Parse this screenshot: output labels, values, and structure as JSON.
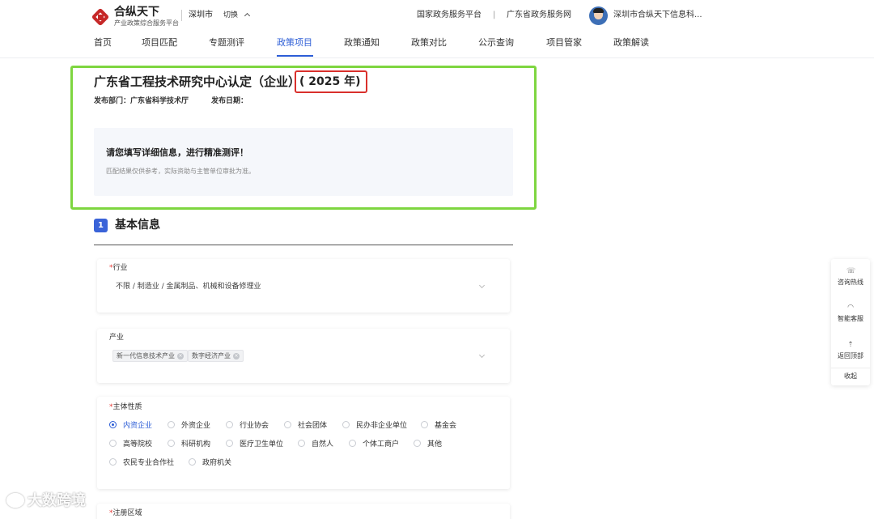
{
  "header": {
    "brand": "合纵天下",
    "brand_sub": "产业政策综合服务平台",
    "city": "深圳市",
    "switch": "切换",
    "link1": "国家政务服务平台",
    "separator": "|",
    "link2": "广东省政务服务网",
    "company": "深圳市合纵天下信息科..."
  },
  "nav": [
    "首页",
    "项目匹配",
    "专题测评",
    "政策项目",
    "政策通知",
    "政策对比",
    "公示查询",
    "项目管家",
    "政策解读"
  ],
  "page": {
    "title": "广东省工程技术研究中心认定（企业）",
    "year": "( 2025 年)",
    "dept_label": "发布部门：广东省科学技术厅",
    "date_label": "发布日期："
  },
  "prompt": {
    "title": "请您填写详细信息，进行精准测评！",
    "subtitle": "匹配结果仅供参考，实际资助与主管单位审批为准。"
  },
  "section": {
    "index": "1",
    "title": "基本信息"
  },
  "industry": {
    "label": "行业",
    "required": "*",
    "value": "不限 / 制造业 / 金属制品、机械和设备修理业"
  },
  "chan_ye": {
    "label": "产业",
    "tags": [
      "新一代信息技术产业",
      "数字经济产业"
    ],
    "remove_glyph": "×"
  },
  "entity": {
    "label": "主体性质",
    "required": "*",
    "options": [
      "内资企业",
      "外资企业",
      "行业协会",
      "社会团体",
      "民办非企业单位",
      "基金会",
      "高等院校",
      "科研机构",
      "医疗卫生单位",
      "自然人",
      "个体工商户",
      "其他",
      "农民专业合作社",
      "政府机关"
    ],
    "selected": "内资企业"
  },
  "region": {
    "label": "注册区域",
    "required": "*"
  },
  "side": {
    "hotline": "咨询热线",
    "service": "智能客服",
    "top": "返回顶部",
    "collapse": "收起"
  },
  "watermark": "大数跨境",
  "colors": {
    "accent": "#2c5dd6",
    "highlight_green": "#7ed640",
    "highlight_red": "#d9302c",
    "required": "#e53935"
  }
}
